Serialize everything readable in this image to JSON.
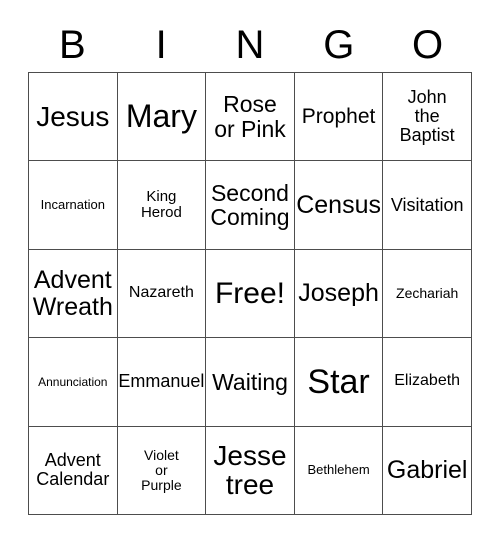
{
  "card": {
    "title_letters": [
      "B",
      "I",
      "N",
      "G",
      "O"
    ],
    "free_space_label": "Free!",
    "colors": {
      "background": "#ffffff",
      "grid_line": "#4d4d4d",
      "text": "#000000"
    },
    "rows": [
      [
        {
          "label": "Jesus",
          "size": "fs-h2"
        },
        {
          "label": "Mary",
          "size": "fs-h4"
        },
        {
          "label": "Rose\nor Pink",
          "size": "fs-xxl"
        },
        {
          "label": "Prophet",
          "size": "fs-xl"
        },
        {
          "label": "John\nthe\nBaptist",
          "size": "fs-l"
        }
      ],
      [
        {
          "label": "Incarnation",
          "size": "fs-s"
        },
        {
          "label": "King\nHerod",
          "size": "fs-m"
        },
        {
          "label": "Second\nComing",
          "size": "fs-xxl"
        },
        {
          "label": "Census",
          "size": "fs-h1"
        },
        {
          "label": "Visitation",
          "size": "fs-l"
        }
      ],
      [
        {
          "label": "Advent\nWreath",
          "size": "fs-h1"
        },
        {
          "label": "Nazareth",
          "size": "fs-ml"
        },
        {
          "label": "Free!",
          "size": "fs-h3"
        },
        {
          "label": "Joseph",
          "size": "fs-h1"
        },
        {
          "label": "Zechariah",
          "size": "fs-sm"
        }
      ],
      [
        {
          "label": "Annunciation",
          "size": "fs-xs"
        },
        {
          "label": "Emmanuel",
          "size": "fs-l"
        },
        {
          "label": "Waiting",
          "size": "fs-xxl"
        },
        {
          "label": "Star",
          "size": "fs-h5"
        },
        {
          "label": "Elizabeth",
          "size": "fs-ml"
        }
      ],
      [
        {
          "label": "Advent\nCalendar",
          "size": "fs-l"
        },
        {
          "label": "Violet\nor\nPurple",
          "size": "fs-sm"
        },
        {
          "label": "Jesse\ntree",
          "size": "fs-h2"
        },
        {
          "label": "Bethlehem",
          "size": "fs-s"
        },
        {
          "label": "Gabriel",
          "size": "fs-h1"
        }
      ]
    ]
  }
}
